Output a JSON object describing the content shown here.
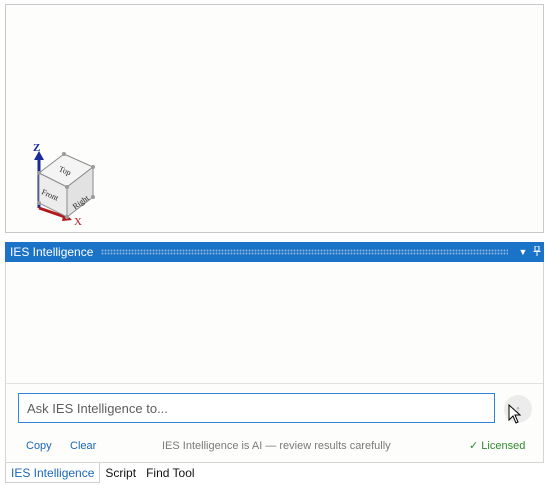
{
  "viewport": {
    "viewcube": {
      "faces": {
        "top": "Top",
        "front": "Front",
        "right": "Right"
      },
      "axes": {
        "z": "Z",
        "x": "X"
      },
      "colors": {
        "z_axis": "#1a2a9a",
        "x_axis": "#b01a1a",
        "face": "#f2f2f2",
        "edge": "#8c8c8c"
      }
    }
  },
  "panel": {
    "title": "IES Intelligence",
    "header_color": "#1a73c6",
    "dropdown_icon": "chevron-down-icon",
    "pin_icon": "pin-icon"
  },
  "chat": {
    "input_placeholder": "Ask IES Intelligence to...",
    "input_value": "",
    "send_icon": "arrow-up-icon",
    "copy_label": "Copy",
    "clear_label": "Clear",
    "ai_note": "IES Intelligence is AI — review results carefully",
    "license_mark": "✓",
    "license_label": "Licensed",
    "license_color": "#2e8b2e"
  },
  "bottom_tabs": [
    {
      "label": "IES Intelligence",
      "active": true
    },
    {
      "label": "Script",
      "active": false
    },
    {
      "label": "Find Tool",
      "active": false
    }
  ]
}
